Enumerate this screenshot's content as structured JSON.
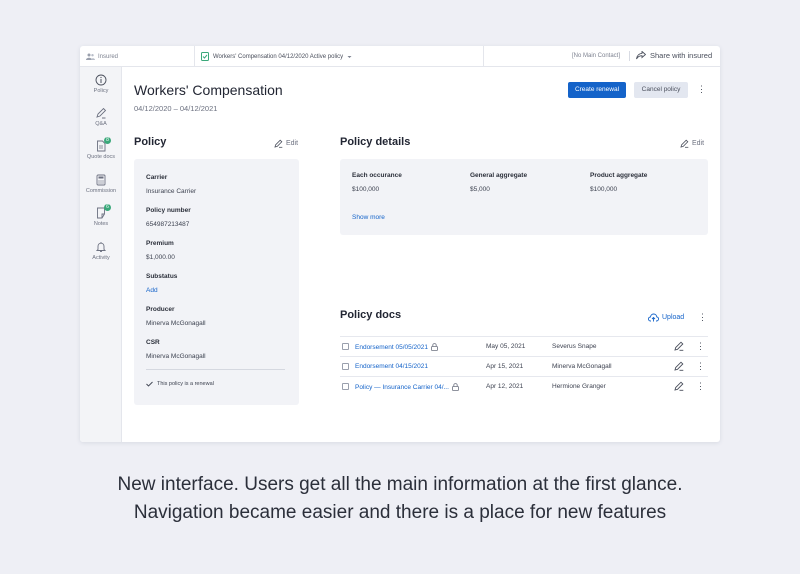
{
  "topbar": {
    "insured_label": "Insured",
    "tab_label": "Workers' Compensation  04/12/2020  Active policy",
    "contact_label": "[No Main Contact]",
    "share_label": "Share with insured"
  },
  "sidebar": {
    "items": [
      {
        "label": "Policy",
        "icon": "info-icon"
      },
      {
        "label": "Q&A",
        "icon": "pen-icon"
      },
      {
        "label": "Quote docs",
        "icon": "doc-icon",
        "badge": "8"
      },
      {
        "label": "Commission",
        "icon": "calculator-icon"
      },
      {
        "label": "Notes",
        "icon": "note-icon",
        "badge": "6"
      },
      {
        "label": "Activity",
        "icon": "bell-icon"
      }
    ]
  },
  "header": {
    "title": "Workers' Compensation",
    "dates": "04/12/2020 – 04/12/2021",
    "create_renewal": "Create renewal",
    "cancel_policy": "Cancel policy"
  },
  "policy": {
    "title": "Policy",
    "edit": "Edit",
    "fields": [
      {
        "label": "Carrier",
        "value": "Insurance Carrier"
      },
      {
        "label": "Policy number",
        "value": "654987213487"
      },
      {
        "label": "Premium",
        "value": "$1,000.00"
      },
      {
        "label": "Substatus",
        "value": "Add"
      },
      {
        "label": "Producer",
        "value": "Minerva McGonagall"
      },
      {
        "label": "CSR",
        "value": "Minerva McGonagall"
      }
    ],
    "renewal_note": "This policy is a renewal"
  },
  "details": {
    "title": "Policy details",
    "edit": "Edit",
    "columns": [
      {
        "label": "Each occurance",
        "value": "$100,000"
      },
      {
        "label": "General aggregate",
        "value": "$5,000"
      },
      {
        "label": "Product aggregate",
        "value": "$100,000"
      }
    ],
    "show_more": "Show more"
  },
  "docs": {
    "title": "Policy docs",
    "upload": "Upload",
    "rows": [
      {
        "name": "Endorsement 05/05/2021",
        "locked": true,
        "date": "May 05, 2021",
        "owner": "Severus Snape"
      },
      {
        "name": "Endorsement 04/15/2021",
        "locked": false,
        "date": "Apr 15, 2021",
        "owner": "Minerva McGonagall"
      },
      {
        "name": "Policy — Insurance Carrier 04/...",
        "locked": true,
        "date": "Apr 12, 2021",
        "owner": "Hermione Granger"
      }
    ]
  },
  "caption": {
    "line1": "New interface. Users get all the main information at the first glance.",
    "line2": "Navigation became easier and there is a place for new features"
  },
  "colors": {
    "accent": "#1463c9",
    "badge": "#3aa87a",
    "background": "#eeeff5",
    "card": "#f2f3f7"
  }
}
